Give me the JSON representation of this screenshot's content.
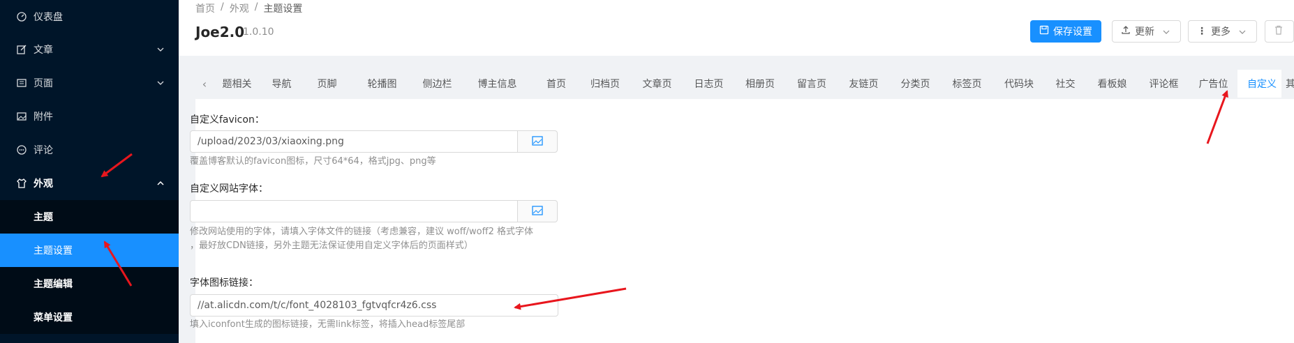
{
  "sidebar": {
    "items": [
      {
        "label": "仪表盘",
        "icon": "dashboard-icon"
      },
      {
        "label": "文章",
        "icon": "edit-icon"
      },
      {
        "label": "页面",
        "icon": "page-icon"
      },
      {
        "label": "附件",
        "icon": "picture-icon"
      },
      {
        "label": "评论",
        "icon": "comment-icon"
      },
      {
        "label": "外观",
        "icon": "skin-icon"
      }
    ],
    "sub_items": [
      {
        "label": "主题"
      },
      {
        "label": "主题设置"
      },
      {
        "label": "主题编辑"
      },
      {
        "label": "菜单设置"
      }
    ]
  },
  "header": {
    "breadcrumb": [
      "首页",
      "/",
      "外观",
      "/",
      "主题设置"
    ],
    "title": "Joe2.0",
    "version": "1.0.10",
    "save_label": "保存设置",
    "update_label": "更新",
    "more_label": "更多"
  },
  "tabs": {
    "items": [
      "题相关",
      "导航",
      "页脚",
      "轮播图",
      "侧边栏",
      "博主信息",
      "首页",
      "归档页",
      "文章页",
      "日志页",
      "相册页",
      "留言页",
      "友链页",
      "分类页",
      "标签页",
      "代码块",
      "社交",
      "看板娘",
      "评论框",
      "广告位",
      "自定义",
      "其它"
    ],
    "active": "自定义"
  },
  "form": {
    "favicon": {
      "label": "自定义favicon：",
      "value": "/upload/2023/03/xiaoxing.png",
      "help": "覆盖博客默认的favicon图标，尺寸64*64，格式jpg、png等"
    },
    "font": {
      "label": "自定义网站字体：",
      "value": "",
      "help_line1": "修改网站使用的字体，请填入字体文件的链接（考虑兼容，建议 woff/woff2 格式字体",
      "help_line2": "，最好放CDN链接，另外主题无法保证使用自定义字体后的页面样式）"
    },
    "iconfont": {
      "label": "字体图标链接：",
      "value": "//at.alicdn.com/t/c/font_4028103_fgtvqfcr4z6.css",
      "help": "填入iconfont生成的图标链接，无需link标签，将插入head标签尾部"
    }
  },
  "colors": {
    "sidebar_bg": "#001529",
    "accent": "#1890ff",
    "annotation": "#e8161d"
  }
}
